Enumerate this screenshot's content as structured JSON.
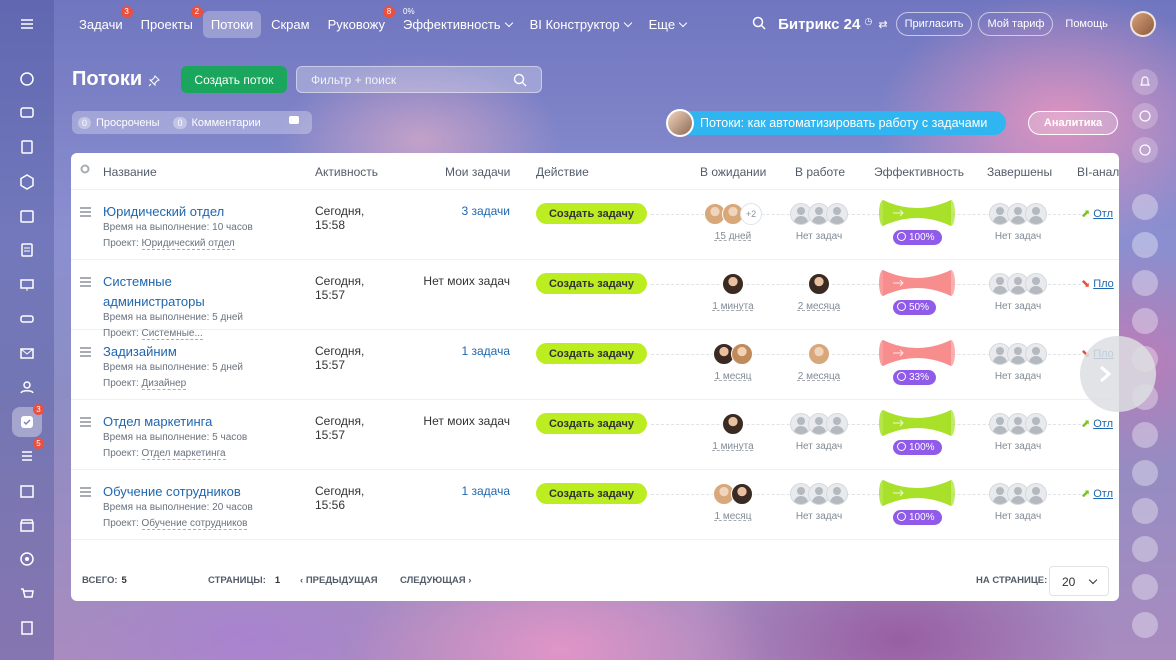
{
  "topnav": {
    "items": [
      {
        "label": "Задачи",
        "badge": "3"
      },
      {
        "label": "Проекты",
        "badge": "2"
      },
      {
        "label": "Потоки",
        "badge": ""
      },
      {
        "label": "Скрам",
        "badge": ""
      },
      {
        "label": "Руковожу",
        "badge": "8"
      },
      {
        "label": "Эффективность",
        "badge": "",
        "sub": "0%"
      },
      {
        "label": "BI Конструктор",
        "badge": ""
      },
      {
        "label": "Еще",
        "badge": ""
      }
    ],
    "brand": "Битрикс 24",
    "invite": "Пригласить",
    "tariff": "Мой тариф",
    "help": "Помощь"
  },
  "sidebar": {
    "badges": {
      "tasks": "3",
      "feed": "5"
    }
  },
  "page": {
    "title": "Потоки",
    "create_button": "Создать поток",
    "search_placeholder": "Фильтр + поиск",
    "counters": [
      {
        "count": "0",
        "label": "Просрочены"
      },
      {
        "count": "0",
        "label": "Комментарии"
      }
    ],
    "promo": "Потоки: как автоматизировать работу с задачами",
    "analytics": "Аналитика"
  },
  "table": {
    "columns": [
      "Название",
      "Активность",
      "Мои задачи",
      "Действие",
      "В ожидании",
      "В работе",
      "Эффективность",
      "Завершены",
      "BI-анал"
    ],
    "time_label": "Время на выполнение:",
    "project_label": "Проект:",
    "action_label": "Создать задачу",
    "rows": [
      {
        "name": "Юридический отдел",
        "time": "10 часов",
        "project": "Юридический отдел",
        "activity1": "Сегодня,",
        "activity2": "15:58",
        "mytasks": "3 задачи",
        "waiting_more": "+2",
        "waiting_sub": "15 дней",
        "work_sub": "Нет задач",
        "eff": "100%",
        "eff_color": "#a8e02a",
        "done_sub": "Нет задач",
        "bi": "Отл"
      },
      {
        "name": "Системные администраторы",
        "time": "5 дней",
        "project": "Системные...",
        "activity1": "Сегодня,",
        "activity2": "15:57",
        "mytasks": "Нет моих задач",
        "waiting_sub": "1 минута",
        "work_sub": "2 месяца",
        "eff": "50%",
        "eff_color": "#f78d8d",
        "done_sub": "Нет задач",
        "bi": "Пло"
      },
      {
        "name": "Задизайним",
        "time": "5 дней",
        "project": "Дизайнер",
        "activity1": "Сегодня,",
        "activity2": "15:57",
        "mytasks": "1 задача",
        "waiting_sub": "1 месяц",
        "work_sub": "2 месяца",
        "eff": "33%",
        "eff_color": "#f78d8d",
        "done_sub": "Нет задач",
        "bi": "Пло"
      },
      {
        "name": "Отдел маркетинга",
        "time": "5 часов",
        "project": "Отдел маркетинга",
        "activity1": "Сегодня,",
        "activity2": "15:57",
        "mytasks": "Нет моих задач",
        "waiting_sub": "1 минута",
        "work_sub": "Нет задач",
        "eff": "100%",
        "eff_color": "#a8e02a",
        "done_sub": "Нет задач",
        "bi": "Отл"
      },
      {
        "name": "Обучение сотрудников",
        "time": "20 часов",
        "project": "Обучение сотрудников",
        "activity1": "Сегодня,",
        "activity2": "15:56",
        "mytasks": "1 задача",
        "waiting_sub": "1 месяц",
        "work_sub": "Нет задач",
        "eff": "100%",
        "eff_color": "#a8e02a",
        "done_sub": "Нет задач",
        "bi": "Отл"
      }
    ]
  },
  "footer": {
    "total_label": "ВСЕГО:",
    "total": "5",
    "pages_label": "СТРАНИЦЫ:",
    "page": "1",
    "prev": "ПРЕДЫДУЩАЯ",
    "next": "СЛЕДУЮЩАЯ",
    "per_page_label": "НА СТРАНИЦЕ:",
    "per_page": "20"
  }
}
